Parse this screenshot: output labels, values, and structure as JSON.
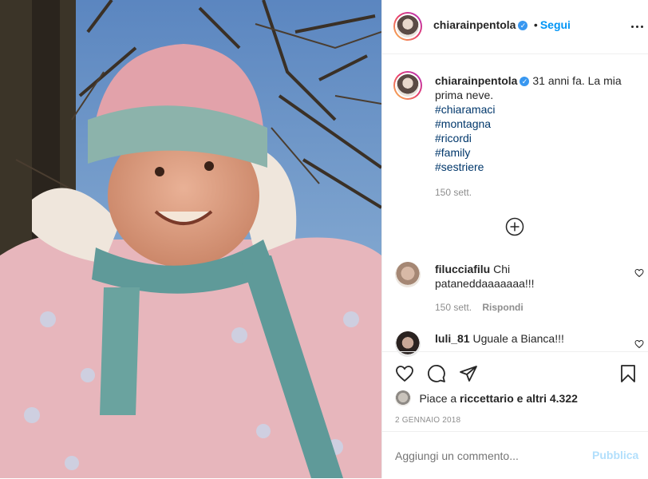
{
  "post": {
    "username": "chiarainpentola",
    "verified_mark": "✓",
    "dot": "•",
    "follow_label": "Segui",
    "caption_text": "31 anni fa. La mia prima neve.",
    "hashtags": [
      "#chiaramaci",
      "#montagna",
      "#ricordi",
      "#family",
      "#sestriere"
    ],
    "caption_time": "150 sett."
  },
  "load_more_icon": "plus-circle-icon",
  "comments": [
    {
      "username": "filucciafilu",
      "text": "Chi pataneddaaaaaaa!!!",
      "time": "150 sett.",
      "reply_label": "Rispondi"
    },
    {
      "username": "luli_81",
      "text": "Uguale a Bianca!!!"
    }
  ],
  "likes": {
    "prefix": "Piace a ",
    "user": "riccettario",
    "suffix": " e altri 4.322"
  },
  "date": "2 GENNAIO 2018",
  "add_comment": {
    "placeholder": "Aggiungi un commento...",
    "publish_label": "Pubblica"
  },
  "colors": {
    "link_blue": "#0095f6",
    "hashtag": "#00376b",
    "muted": "#8e8e8e",
    "border": "#efefef"
  }
}
